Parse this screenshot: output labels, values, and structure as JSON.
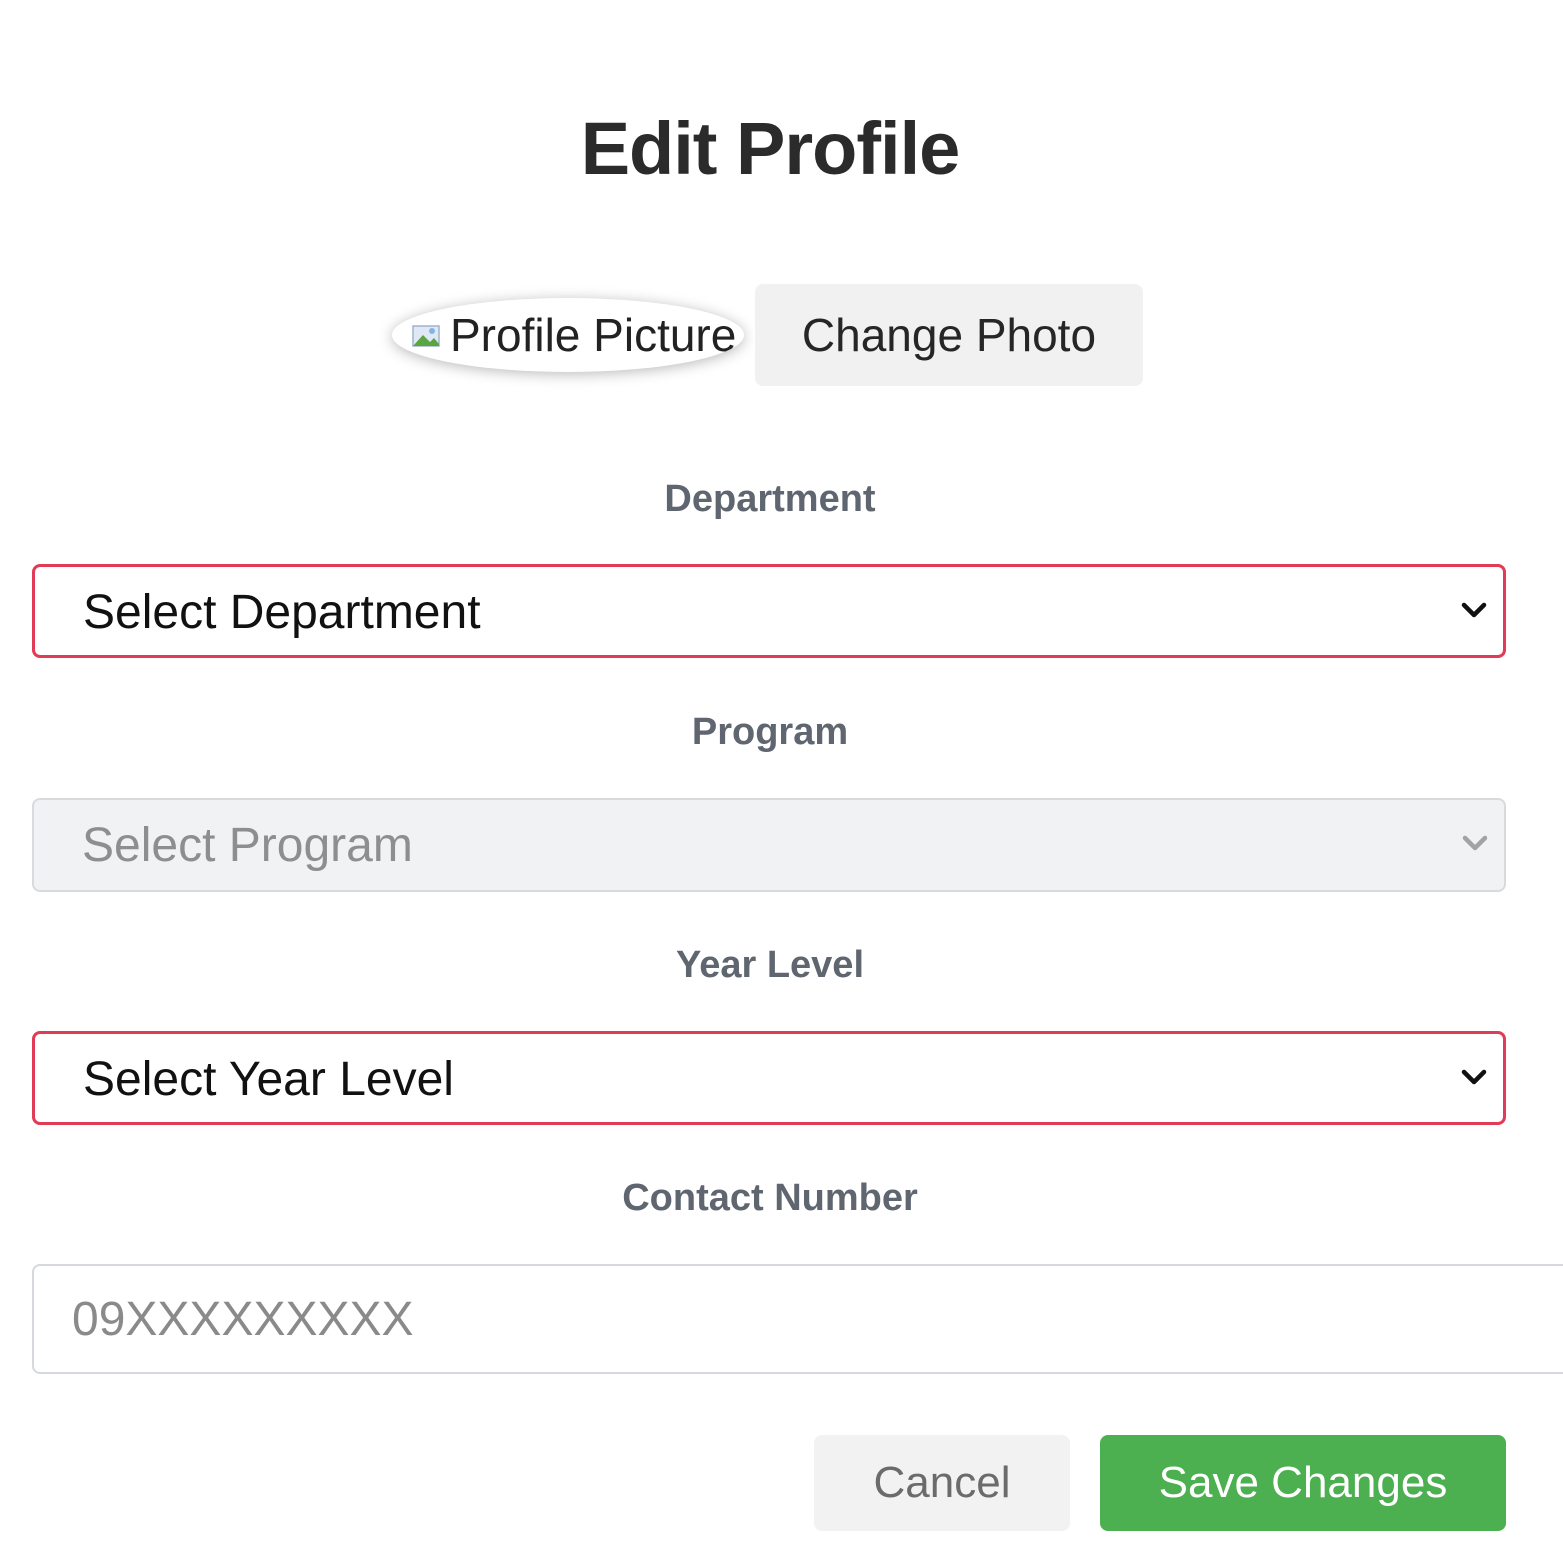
{
  "modal": {
    "title": "Edit Profile"
  },
  "photo": {
    "alt_text": "Profile Picture",
    "change_label": "Change Photo"
  },
  "fields": {
    "department": {
      "label": "Department",
      "value": "Select Department",
      "state": "invalid"
    },
    "program": {
      "label": "Program",
      "value": "Select Program",
      "state": "disabled"
    },
    "year_level": {
      "label": "Year Level",
      "value": "Select Year Level",
      "state": "invalid"
    },
    "contact": {
      "label": "Contact Number",
      "placeholder": "09XXXXXXXXX"
    }
  },
  "actions": {
    "cancel_label": "Cancel",
    "save_label": "Save Changes"
  },
  "colors": {
    "invalid_border": "#e23b55",
    "save_button": "#4caf50",
    "label_text": "#5f6670"
  },
  "icons": {
    "broken_image": "broken-image-icon",
    "dropdown": "chevron-down-icon"
  }
}
